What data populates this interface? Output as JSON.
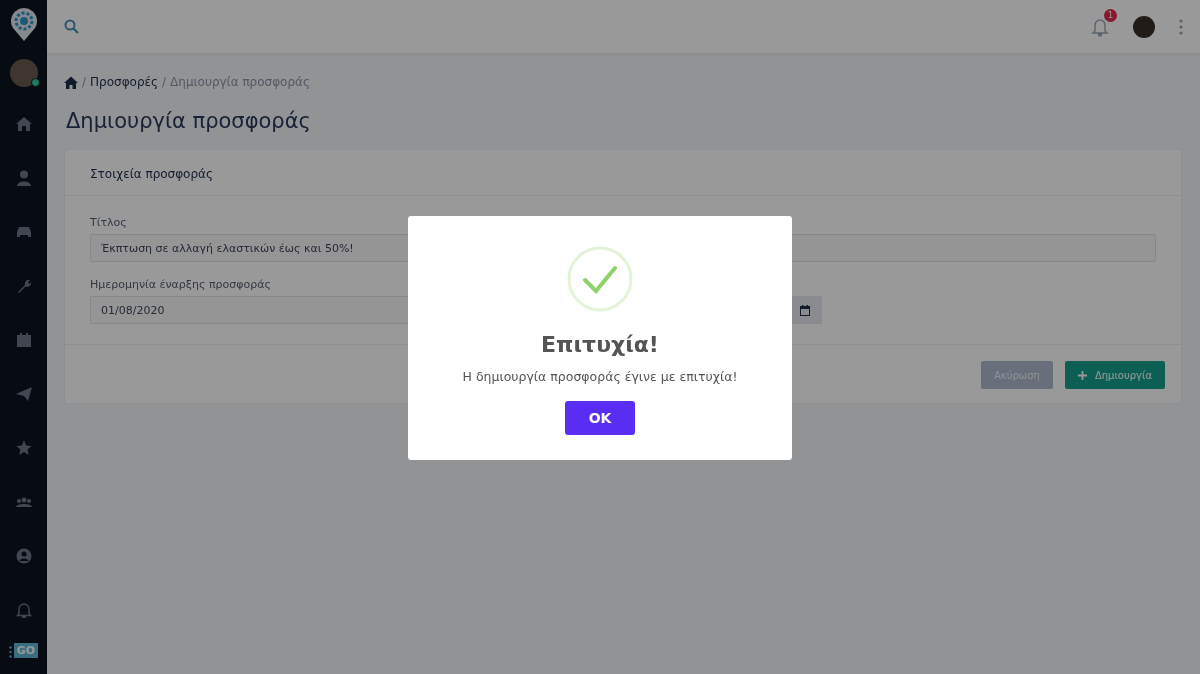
{
  "sidebar": {
    "user": {
      "online": true
    },
    "footer_logo": "GO"
  },
  "topbar": {
    "notifications": {
      "count": "1"
    }
  },
  "breadcrumb": [
    {
      "separator": "/",
      "label": "Προσφορές",
      "current": false
    },
    {
      "separator": "/",
      "label": "Δημιουργία προσφοράς",
      "current": true
    }
  ],
  "page_title": "Δημιουργία προσφοράς",
  "card": {
    "title": "Στοιχεία προσφοράς",
    "fields": [
      {
        "label": "Τίτλος",
        "value": "Έκπτωση σε αλλαγή ελαστικών έως και 50%!",
        "kind": "text"
      },
      {
        "label": "Ημερομηνία έναρξης προσφοράς",
        "value": "01/08/2020",
        "kind": "date"
      }
    ],
    "buttons": [
      {
        "label": "Ακύρωση",
        "kind": "cancel"
      },
      {
        "label": "Δημιουργία",
        "kind": "create"
      }
    ]
  },
  "dialog": {
    "title": "Επιτυχία!",
    "message": "Η δημιουργία προσφοράς έγινε με επιτυχία!",
    "button": "OK"
  }
}
